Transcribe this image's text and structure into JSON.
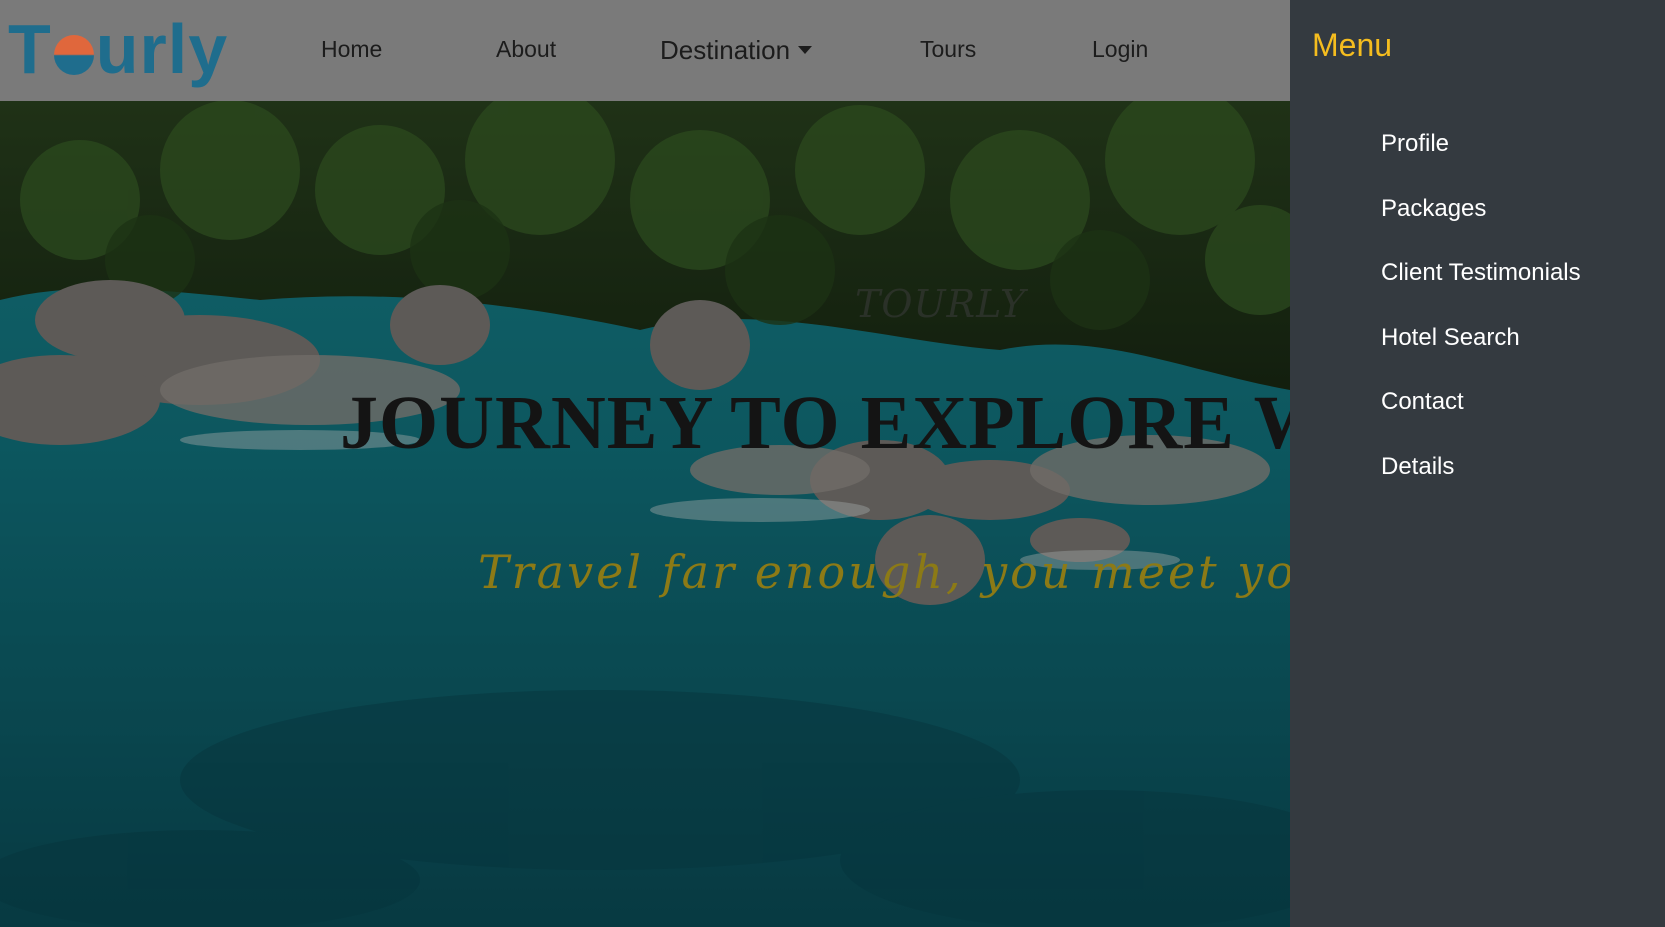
{
  "brand": {
    "logo_text": "Tourly",
    "logo_prefix": "T",
    "logo_suffix": "urly"
  },
  "nav": {
    "items": [
      {
        "label": "Home"
      },
      {
        "label": "About"
      },
      {
        "label": "Destination"
      },
      {
        "label": "Tours"
      },
      {
        "label": "Login"
      }
    ],
    "dropdown_icon": "caret-down-icon"
  },
  "hero": {
    "watermark": "TOURLY",
    "headline": "JOURNEY TO EXPLORE WO",
    "tagline": "Travel far enough, you meet yourself..."
  },
  "side_menu": {
    "title": "Menu",
    "items": [
      {
        "label": "Profile"
      },
      {
        "label": "Packages"
      },
      {
        "label": "Client Testimonials"
      },
      {
        "label": "Hotel Search"
      },
      {
        "label": "Contact"
      },
      {
        "label": "Details"
      }
    ]
  },
  "colors": {
    "navbar_bg": "#7a7a7a",
    "sidemenu_bg": "#343a40",
    "menu_title": "#f5bd1f",
    "logo_blue": "#1f6d8d",
    "logo_orange": "#e0673c",
    "tagline": "#8c7a16"
  }
}
